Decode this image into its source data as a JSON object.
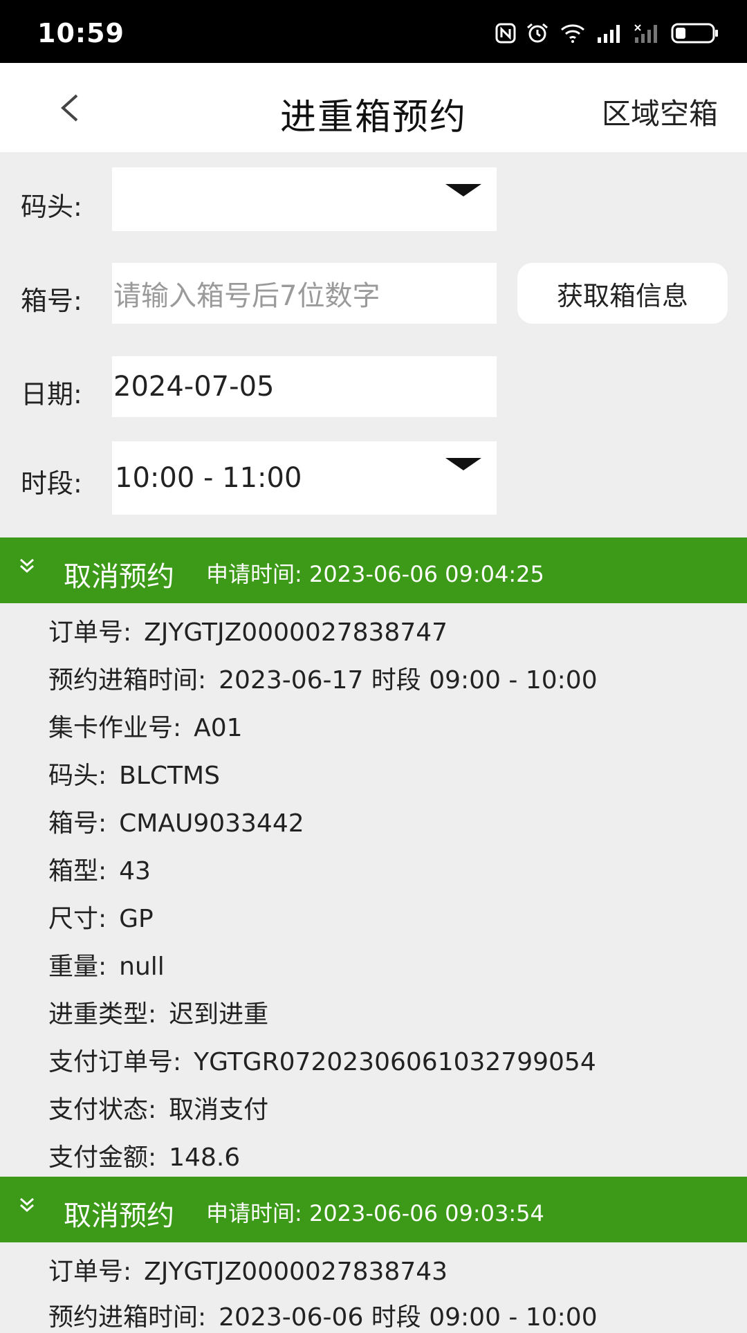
{
  "status_bar": {
    "time": "10:59",
    "icons": [
      "nfc-icon",
      "alarm-icon",
      "wifi-icon",
      "signal-icon",
      "signal-off-icon",
      "battery-icon"
    ]
  },
  "header": {
    "back_icon": "chevron-left-icon",
    "title": "进重箱预约",
    "right_link": "区域空箱"
  },
  "form": {
    "terminal": {
      "label": "码头:",
      "value": ""
    },
    "container": {
      "label": "箱号:",
      "placeholder": "请输入箱号后7位数字",
      "button": "获取箱信息"
    },
    "date": {
      "label": "日期:",
      "value": "2024-07-05"
    },
    "timeslot": {
      "label": "时段:",
      "value": "10:00 - 11:00"
    }
  },
  "accent_color": "#3c9a18",
  "records": [
    {
      "status": "取消预约",
      "apply_time": "申请时间: 2023-06-06   09:04:25",
      "details": [
        {
          "k": "订单号:",
          "v": "ZJYGTJZ0000027838747"
        },
        {
          "k": "预约进箱时间:",
          "v": "2023-06-17 时段 09:00 - 10:00"
        },
        {
          "k": "集卡作业号:",
          "v": "A01"
        },
        {
          "k": "码头:",
          "v": "BLCTMS"
        },
        {
          "k": "箱号:",
          "v": "CMAU9033442"
        },
        {
          "k": "箱型:",
          "v": "43"
        },
        {
          "k": "尺寸:",
          "v": "GP"
        },
        {
          "k": "重量:",
          "v": "null"
        },
        {
          "k": "进重类型:",
          "v": "迟到进重"
        },
        {
          "k": "支付订单号:",
          "v": "YGTGR072023060610327990​54"
        },
        {
          "k": "支付状态:",
          "v": "取消支付"
        },
        {
          "k": "支付金额:",
          "v": "148.6"
        }
      ]
    },
    {
      "status": "取消预约",
      "apply_time": "申请时间: 2023-06-06   09:03:54",
      "details": [
        {
          "k": "订单号:",
          "v": "ZJYGTJZ0000027838743"
        },
        {
          "k": "预约进箱时间:",
          "v": "2023-06-06 时段 09:00 - 10:00"
        }
      ]
    }
  ]
}
